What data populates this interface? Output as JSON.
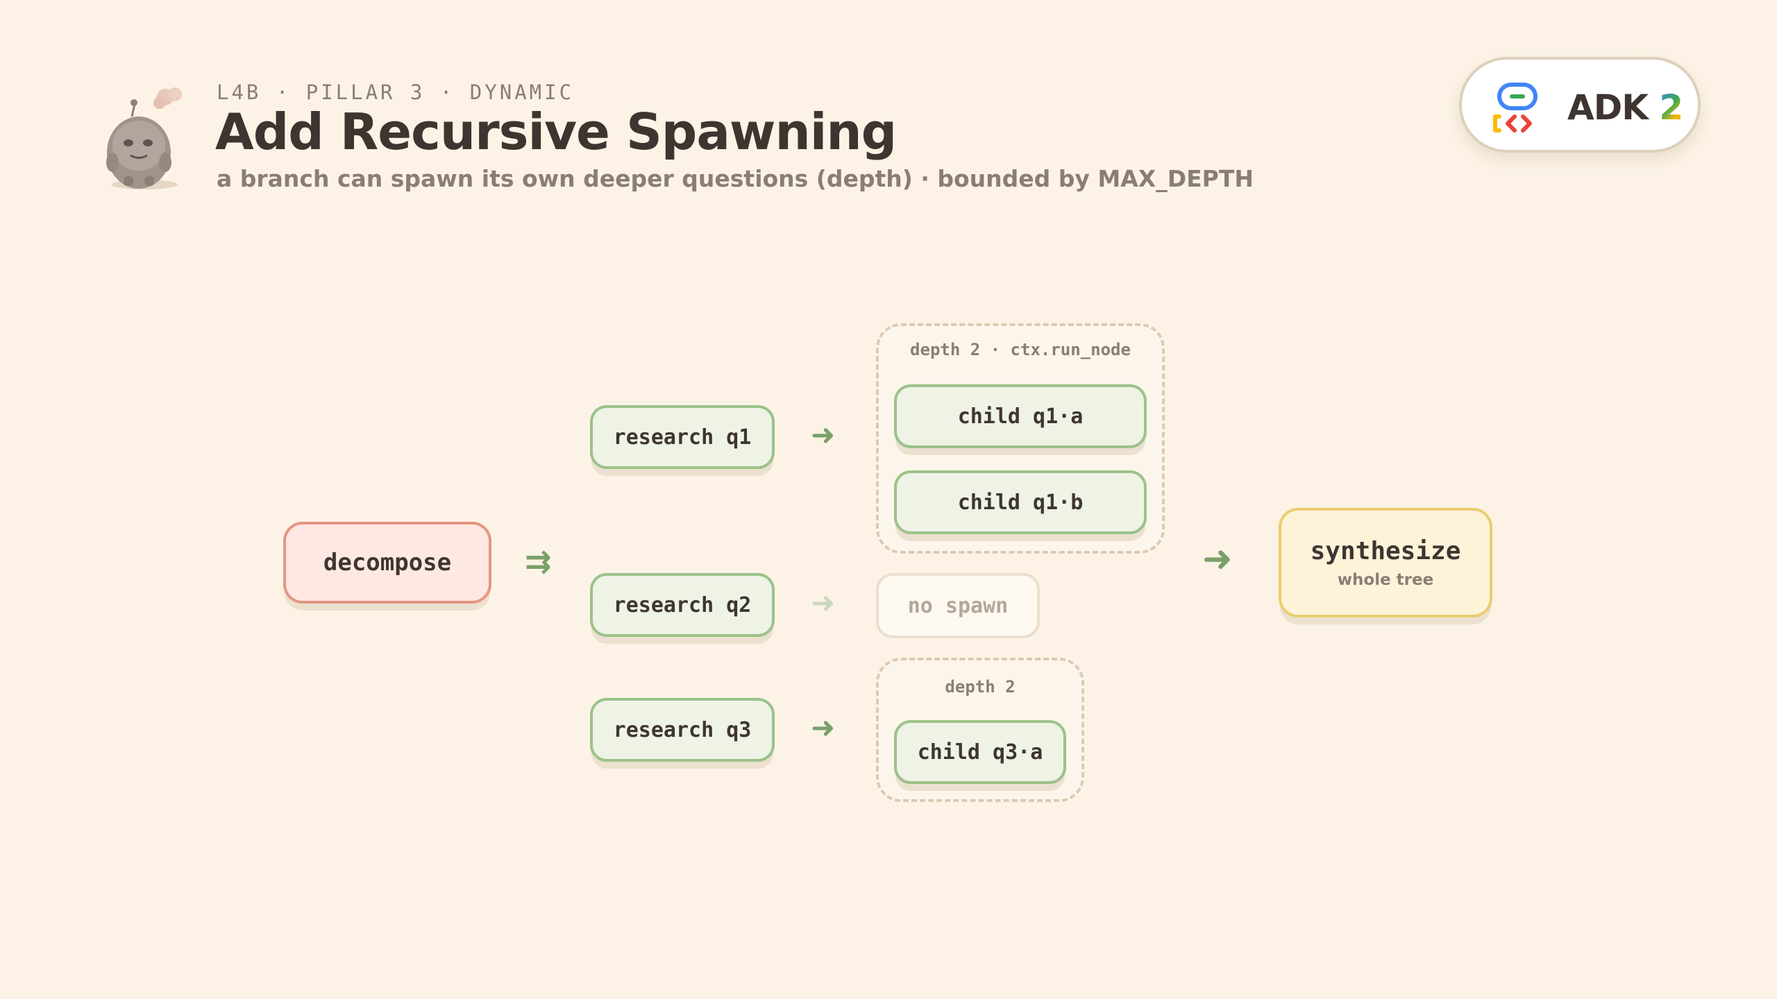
{
  "header": {
    "eyebrow": "L4B · PILLAR 3 · DYNAMIC",
    "title": "Add Recursive Spawning",
    "subtitle": "a branch can spawn its own deeper questions (depth) · bounded by MAX_DEPTH"
  },
  "brand": {
    "name": "ADK",
    "version": "2",
    "colors": [
      "#4285f4",
      "#34a853",
      "#fbbc04",
      "#ea4335"
    ]
  },
  "diagram": {
    "root": {
      "label": "decompose"
    },
    "fan_out_arrow": "⇉",
    "arrow": "➜",
    "branches": [
      {
        "label": "research q1"
      },
      {
        "label": "research q2"
      },
      {
        "label": "research q3"
      }
    ],
    "groups": [
      {
        "label": "depth 2 · ctx.run_node",
        "children": [
          "child q1·a",
          "child q1·b"
        ]
      },
      {
        "label": "depth 2",
        "children": [
          "child q3·a"
        ]
      }
    ],
    "no_spawn": {
      "label": "no spawn"
    },
    "sink": {
      "title": "synthesize",
      "subtitle": "whole tree"
    }
  },
  "colors": {
    "background": "#fcf3e6",
    "root_fill": "#fde9e2",
    "root_border": "#e59580",
    "branch_fill": "#eef3e6",
    "branch_border": "#9cc289",
    "sink_fill": "#fdf3d9",
    "sink_border": "#ebcd6e",
    "arrow": "#7aa069",
    "group_border": "#ddcab4"
  },
  "icons": {
    "mascot": "clay-creature-icon",
    "brand_logo": "adk-logo-icon"
  }
}
